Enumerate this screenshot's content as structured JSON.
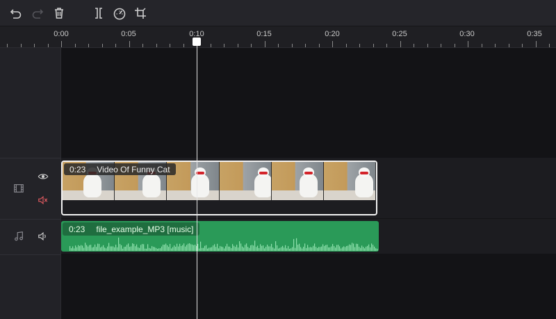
{
  "toolbar": {
    "buttons": [
      "undo-icon",
      "redo-icon",
      "delete-icon",
      "split-icon",
      "speed-icon",
      "crop-icon"
    ]
  },
  "ruler": {
    "labels": [
      "0:00",
      "0:05",
      "0:10",
      "0:15",
      "0:20",
      "0:25",
      "0:30",
      "0:35"
    ]
  },
  "tracks": {
    "video": {
      "clip": {
        "duration": "0:23",
        "title": "Video Of Funny Cat"
      }
    },
    "audio": {
      "clip": {
        "duration": "0:23",
        "title": "file_example_MP3 [music]"
      }
    }
  },
  "playhead": {
    "time": "0:10"
  },
  "colors": {
    "audio_clip": "#2a9a58",
    "audio_label_bg": "#1f6d3f",
    "mute_icon": "#e05a60",
    "playhead": "#ffffff"
  }
}
